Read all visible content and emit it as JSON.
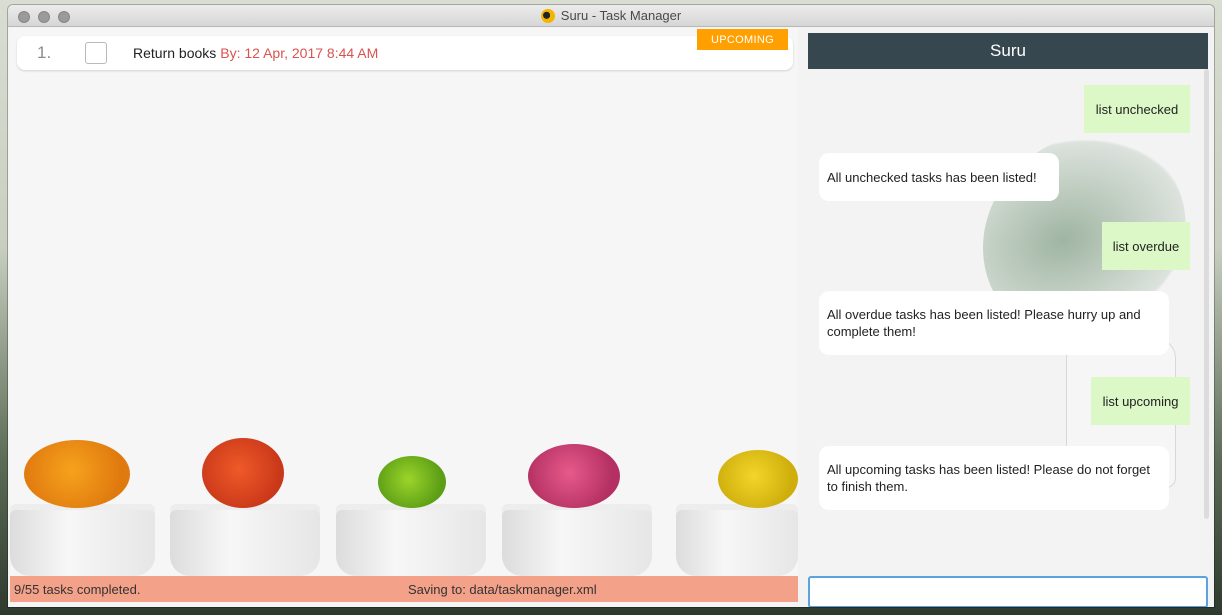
{
  "window": {
    "title": "Suru - Task Manager",
    "controls": [
      "close",
      "minimize",
      "zoom"
    ]
  },
  "task_list": {
    "tasks": [
      {
        "index": "1.",
        "title": "Return books",
        "due": "By: 12 Apr, 2017 8:44 AM",
        "badge": "UPCOMING",
        "checked": false
      }
    ]
  },
  "status_bar": {
    "completed": "9/55 tasks completed.",
    "saving": "Saving to: data/taskmanager.xml"
  },
  "chat": {
    "header": "Suru",
    "messages": [
      {
        "from": "user",
        "text": "list unchecked"
      },
      {
        "from": "bot",
        "text": "All unchecked tasks has been listed!"
      },
      {
        "from": "user",
        "text": "list overdue"
      },
      {
        "from": "bot",
        "text": "All overdue tasks has been listed! Please hurry up and complete them!"
      },
      {
        "from": "user",
        "text": "list upcoming"
      },
      {
        "from": "bot",
        "text": "All upcoming tasks has been listed! Please do not forget to finish them."
      }
    ],
    "input_value": ""
  },
  "colors": {
    "badge": "#ffa000",
    "due_text": "#d9534f",
    "status_bar": "#f4a18a",
    "chat_header": "#37474f",
    "user_bubble": "#dcf8c6",
    "bot_bubble": "#ffffff"
  }
}
